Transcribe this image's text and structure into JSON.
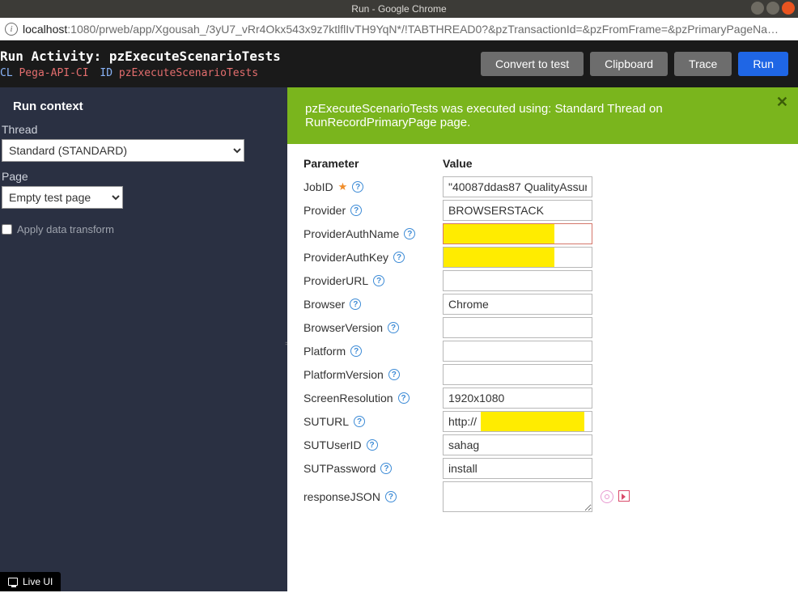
{
  "window": {
    "title": "Run - Google Chrome"
  },
  "url": {
    "host": "localhost",
    "rest": ":1080/prweb/app/Xgousah_/3yU7_vRr4Okx543x9z7ktlflIvTH9YqN*/!TABTHREAD0?&pzTransactionId=&pzFromFrame=&pzPrimaryPageNa…"
  },
  "header": {
    "title": "Run Activity: pzExecuteScenarioTests",
    "cl_label": "CL",
    "cl_value": "Pega-API-CI",
    "id_label": "ID",
    "id_value": "pzExecuteScenarioTests"
  },
  "toolbar": {
    "convert": "Convert to test",
    "clipboard": "Clipboard",
    "trace": "Trace",
    "run": "Run"
  },
  "runcontext": {
    "heading": "Run context",
    "thread_label": "Thread",
    "thread_value": "Standard (STANDARD)",
    "page_label": "Page",
    "page_value": "Empty test page",
    "apply_dt": "Apply data transform"
  },
  "banner": {
    "text": "pzExecuteScenarioTests was executed using: Standard Thread on RunRecordPrimaryPage page."
  },
  "params": {
    "header_param": "Parameter",
    "header_value": "Value",
    "rows": [
      {
        "label": "JobID",
        "required": true,
        "value": "\"40087ddas87 QualityAssur"
      },
      {
        "label": "Provider",
        "required": false,
        "value": "BROWSERSTACK"
      },
      {
        "label": "ProviderAuthName",
        "required": false,
        "value": "",
        "redacted": true,
        "redborder": true
      },
      {
        "label": "ProviderAuthKey",
        "required": false,
        "value": "",
        "redacted": true
      },
      {
        "label": "ProviderURL",
        "required": false,
        "value": ""
      },
      {
        "label": "Browser",
        "required": false,
        "value": "Chrome"
      },
      {
        "label": "BrowserVersion",
        "required": false,
        "value": ""
      },
      {
        "label": "Platform",
        "required": false,
        "value": ""
      },
      {
        "label": "PlatformVersion",
        "required": false,
        "value": ""
      },
      {
        "label": "ScreenResolution",
        "required": false,
        "value": "1920x1080"
      },
      {
        "label": "SUTURL",
        "required": false,
        "value": "http://",
        "partial_redact": true
      },
      {
        "label": "SUTUserID",
        "required": false,
        "value": "sahag"
      },
      {
        "label": "SUTPassword",
        "required": false,
        "value": "install"
      },
      {
        "label": "responseJSON",
        "required": false,
        "value": "",
        "textarea": true,
        "trailing_icons": true
      }
    ]
  },
  "liveui": {
    "label": "Live UI"
  }
}
